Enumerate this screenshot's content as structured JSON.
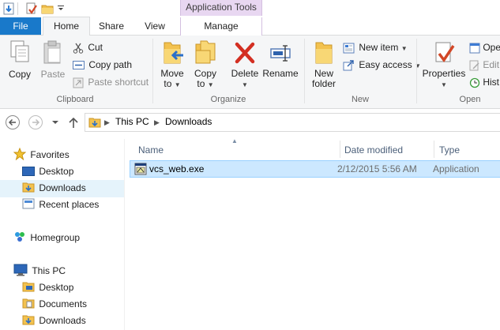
{
  "title_bar": {
    "context_tab_header": "Application Tools"
  },
  "tabs": {
    "file": "File",
    "home": "Home",
    "share": "Share",
    "view": "View",
    "manage": "Manage"
  },
  "ribbon": {
    "clipboard": {
      "copy": "Copy",
      "paste": "Paste",
      "cut": "Cut",
      "copy_path": "Copy path",
      "paste_shortcut": "Paste shortcut",
      "group_label": "Clipboard"
    },
    "organize": {
      "move_to_line1": "Move",
      "move_to_line2": "to",
      "copy_to_line1": "Copy",
      "copy_to_line2": "to",
      "delete": "Delete",
      "rename": "Rename",
      "group_label": "Organize"
    },
    "new": {
      "new_folder_line1": "New",
      "new_folder_line2": "folder",
      "new_item": "New item",
      "easy_access": "Easy access",
      "group_label": "New"
    },
    "open": {
      "properties": "Properties",
      "open": "Ope",
      "edit": "Edit",
      "history": "Hist",
      "group_label": "Open"
    }
  },
  "address_bar": {
    "crumb_1": "This PC",
    "crumb_2": "Downloads"
  },
  "nav_pane": {
    "favorites": "Favorites",
    "desktop": "Desktop",
    "downloads": "Downloads",
    "recent_places": "Recent places",
    "homegroup": "Homegroup",
    "this_pc": "This PC",
    "pc_desktop": "Desktop",
    "pc_documents": "Documents",
    "pc_downloads": "Downloads"
  },
  "file_list": {
    "columns": {
      "name": "Name",
      "date_modified": "Date modified",
      "type": "Type"
    },
    "rows": [
      {
        "name": "vcs_web.exe",
        "date_modified": "2/12/2015 5:56 AM",
        "type": "Application"
      }
    ]
  },
  "colors": {
    "file_tab": "#1979ca",
    "context_tab": "#e8d7f1",
    "selection": "#cce8ff",
    "selection_border": "#99d1ff",
    "ribbon_bg": "#f5f6f7"
  }
}
